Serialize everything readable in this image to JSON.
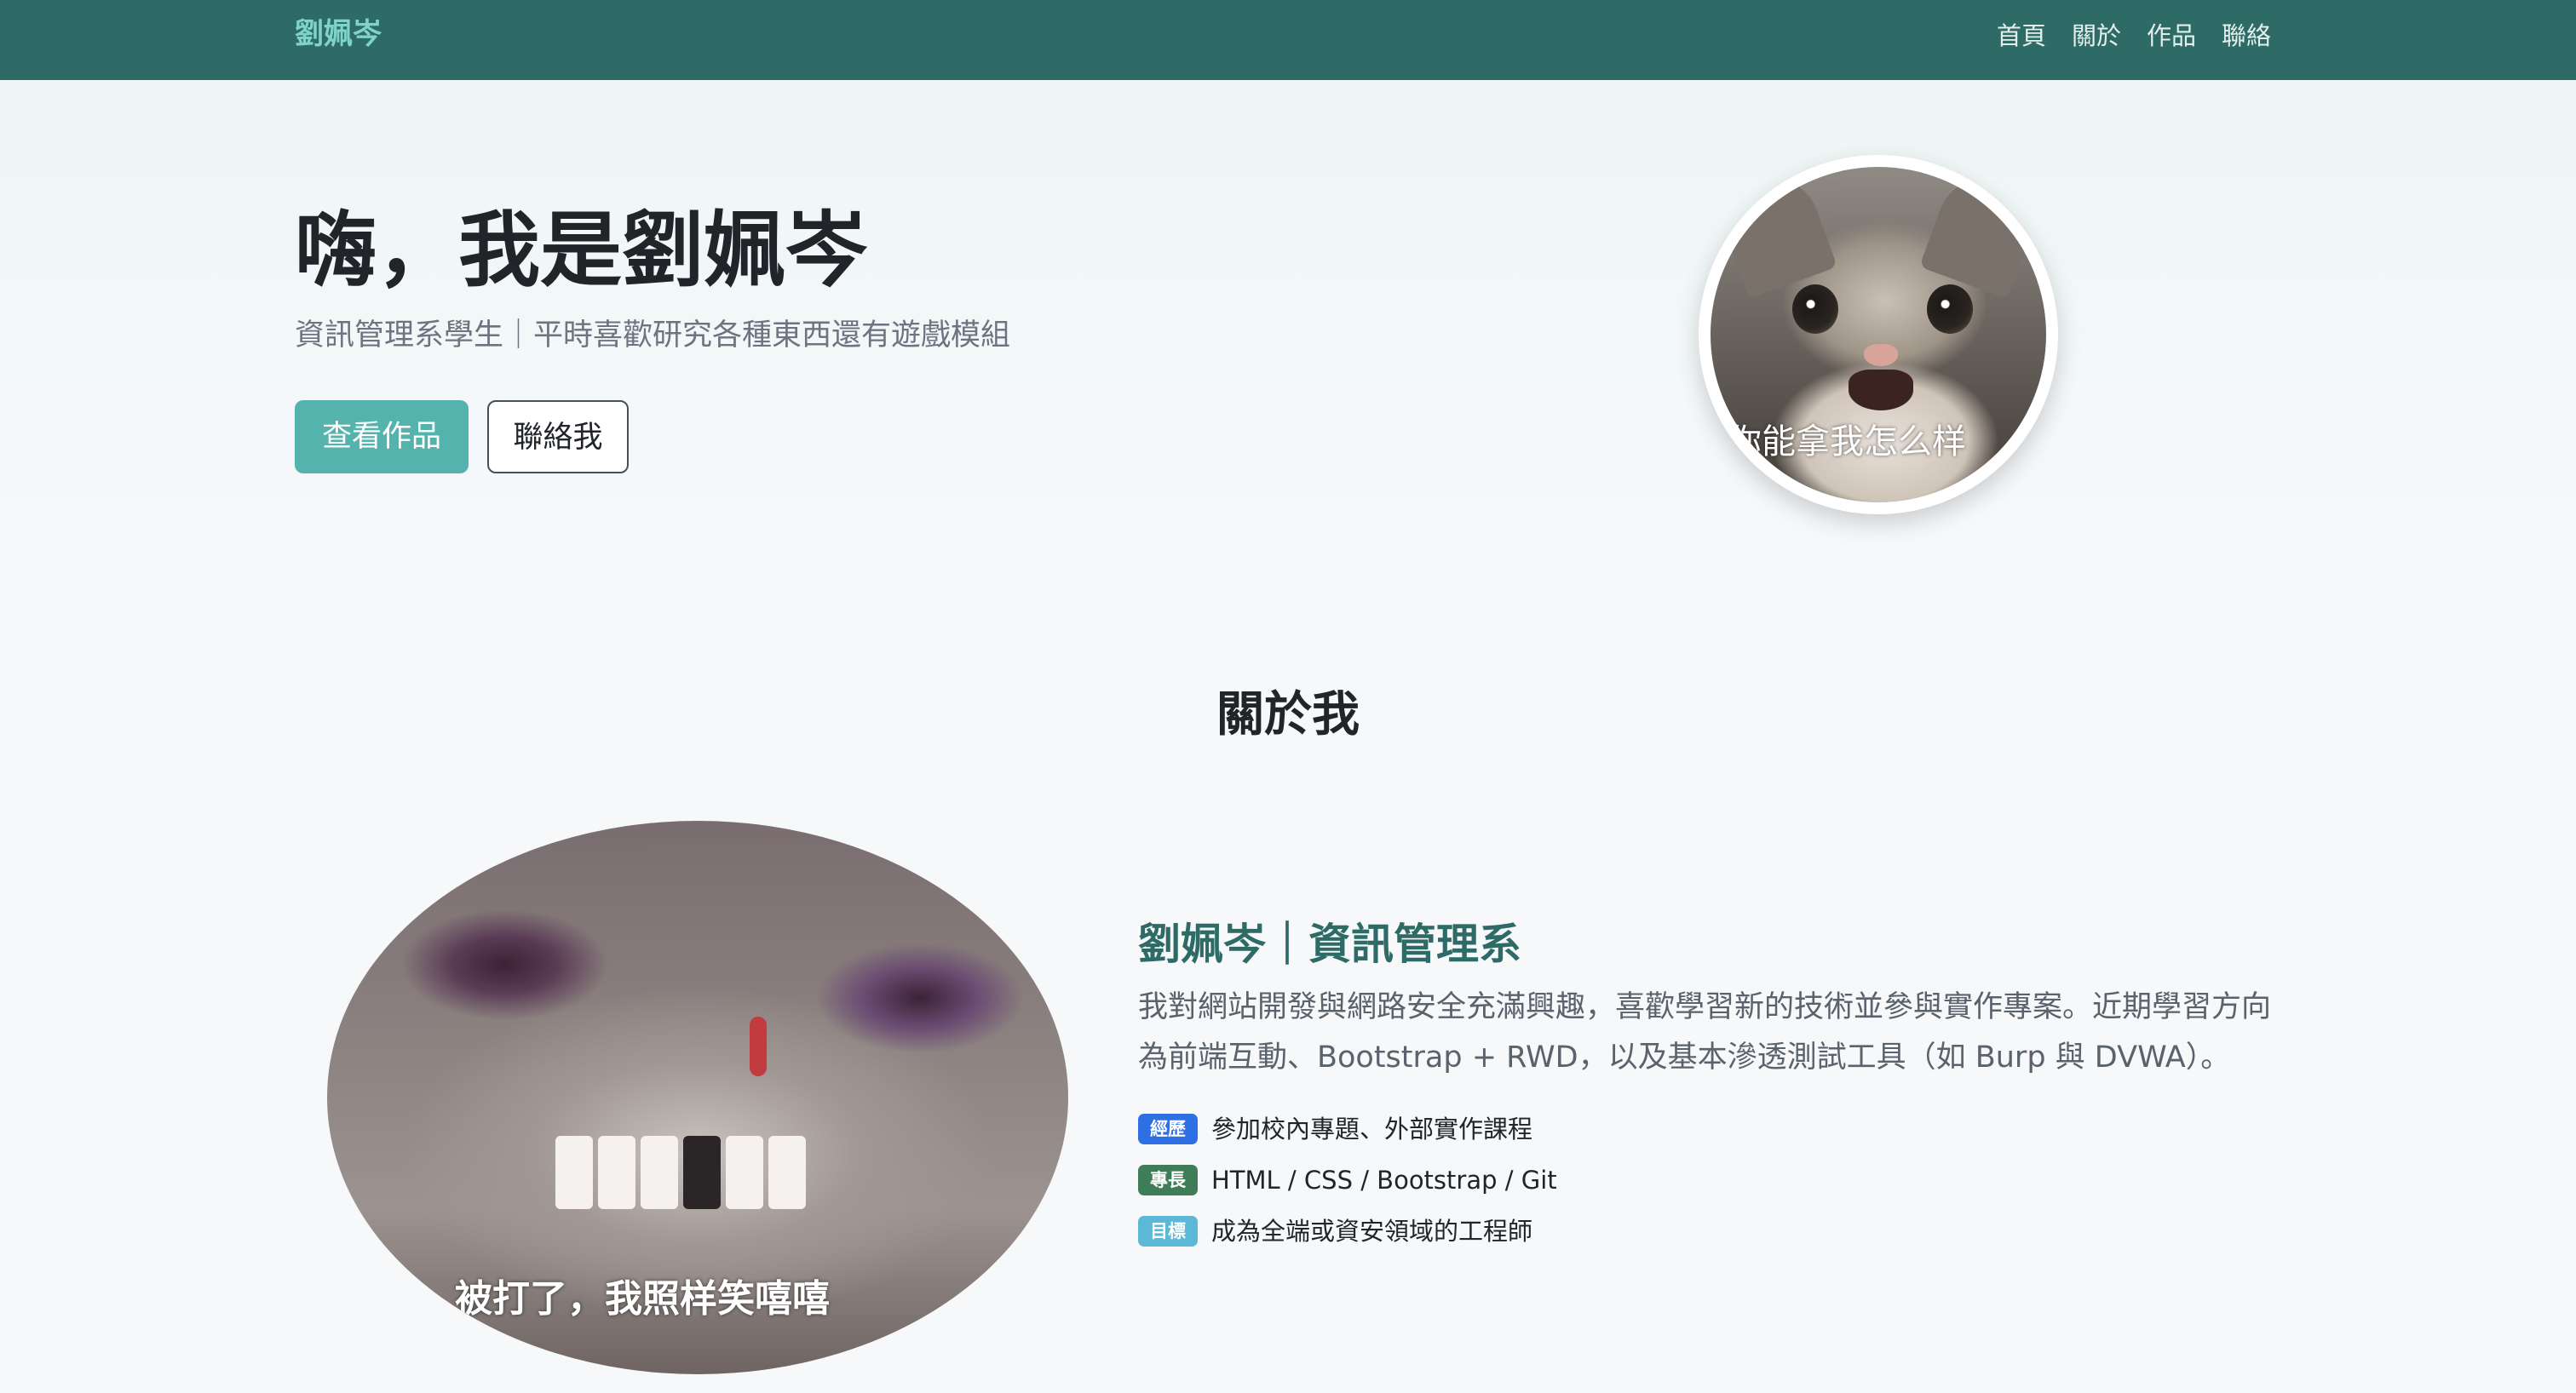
{
  "navbar": {
    "brand": "劉姵岑",
    "links": [
      "首頁",
      "關於",
      "作品",
      "聯絡"
    ]
  },
  "hero": {
    "title": "嗨，我是劉姵岑",
    "subtitle": "資訊管理系學生｜平時喜歡研究各種東西還有遊戲模組",
    "primary_button": "查看作品",
    "secondary_button": "聯絡我",
    "avatar_caption": "你能拿我怎么样"
  },
  "about": {
    "section_title": "關於我",
    "photo_caption": "被打了，我照样笑嘻嘻",
    "name_line": "劉姵岑｜資訊管理系",
    "description": "我對網站開發與網路安全充滿興趣，喜歡學習新的技術並參與實作專案。近期學習方向為前端互動、Bootstrap + RWD，以及基本滲透測試工具（如 Burp 與 DVWA）。",
    "facts": [
      {
        "badge": "經歷",
        "badge_color": "#2f6fe4",
        "text": "參加校內專題、外部實作課程"
      },
      {
        "badge": "專長",
        "badge_color": "#3f7d58",
        "text": "HTML / CSS / Bootstrap / Git"
      },
      {
        "badge": "目標",
        "badge_color": "#5bb8d6",
        "text": "成為全端或資安領域的工程師"
      }
    ]
  },
  "colors": {
    "navbar_bg": "#2e6b66",
    "brand": "#7fd3c8",
    "primary_button": "#55b3ad",
    "accent_heading": "#2e6b66"
  }
}
